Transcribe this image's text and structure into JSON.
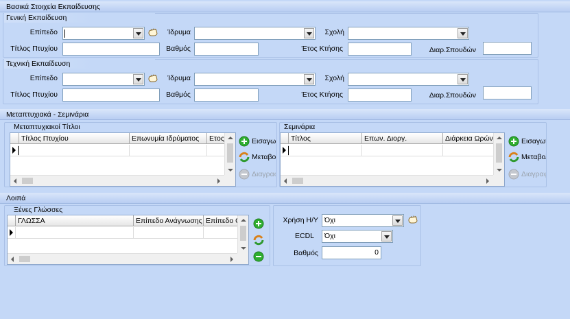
{
  "section_basic": {
    "title": "Βασικά Στοιχεία Εκπαίδευσης"
  },
  "general_edu": {
    "title": "Γενική Εκπαίδευση",
    "level_label": "Επίπεδο",
    "institution_label": "Ίδρυμα",
    "school_label": "Σχολή",
    "degree_title_label": "Τίτλος Πτυχίου",
    "grade_label": "Βαθμός",
    "year_label": "Έτος Κτήσης",
    "duration_label": "Διαρ.Σπουδών"
  },
  "technical_edu": {
    "title": "Τεχνική Εκπαίδευση",
    "level_label": "Επίπεδο",
    "institution_label": "Ίδρυμα",
    "school_label": "Σχολή",
    "degree_title_label": "Τίτλος Πτυχίου",
    "grade_label": "Βαθμός",
    "year_label": "Έτος Κτήσης",
    "duration_label": "Διαρ.Σπουδών"
  },
  "section_postgrad": {
    "title": "Μεταπτυχιακά - Σεμινάρια"
  },
  "postgrad_titles": {
    "title": "Μεταπτυχιακοί Τίτλοι",
    "columns": [
      "Τίτλος Πτυχίου",
      "Επωνυμία Ιδρύματος",
      "Ετος"
    ],
    "insert_label": "Εισαγωγή",
    "modify_label": "Μεταβολή",
    "delete_label": "Διαγραφή"
  },
  "seminars": {
    "title": "Σεμινάρια",
    "columns": [
      "Τίτλος",
      "Επων. Διοργ.",
      "Διάρκεια Ωρών"
    ],
    "insert_label": "Εισαγωγή",
    "modify_label": "Μεταβολή",
    "delete_label": "Διαγραφή"
  },
  "section_other": {
    "title": "Λοιπά"
  },
  "languages": {
    "title": "Ξένες Γλώσσες",
    "columns": [
      "ΓΛΩΣΣΑ",
      "Επίπεδο Ανάγνωσης",
      "Επίπεδο Ο"
    ]
  },
  "computer": {
    "pc_use_label": "Χρήση Η/Υ",
    "pc_use_value": "Όχι",
    "ecdl_label": "ECDL",
    "ecdl_value": "Όχι",
    "grade_label": "Βαθμός",
    "grade_value": "0"
  }
}
